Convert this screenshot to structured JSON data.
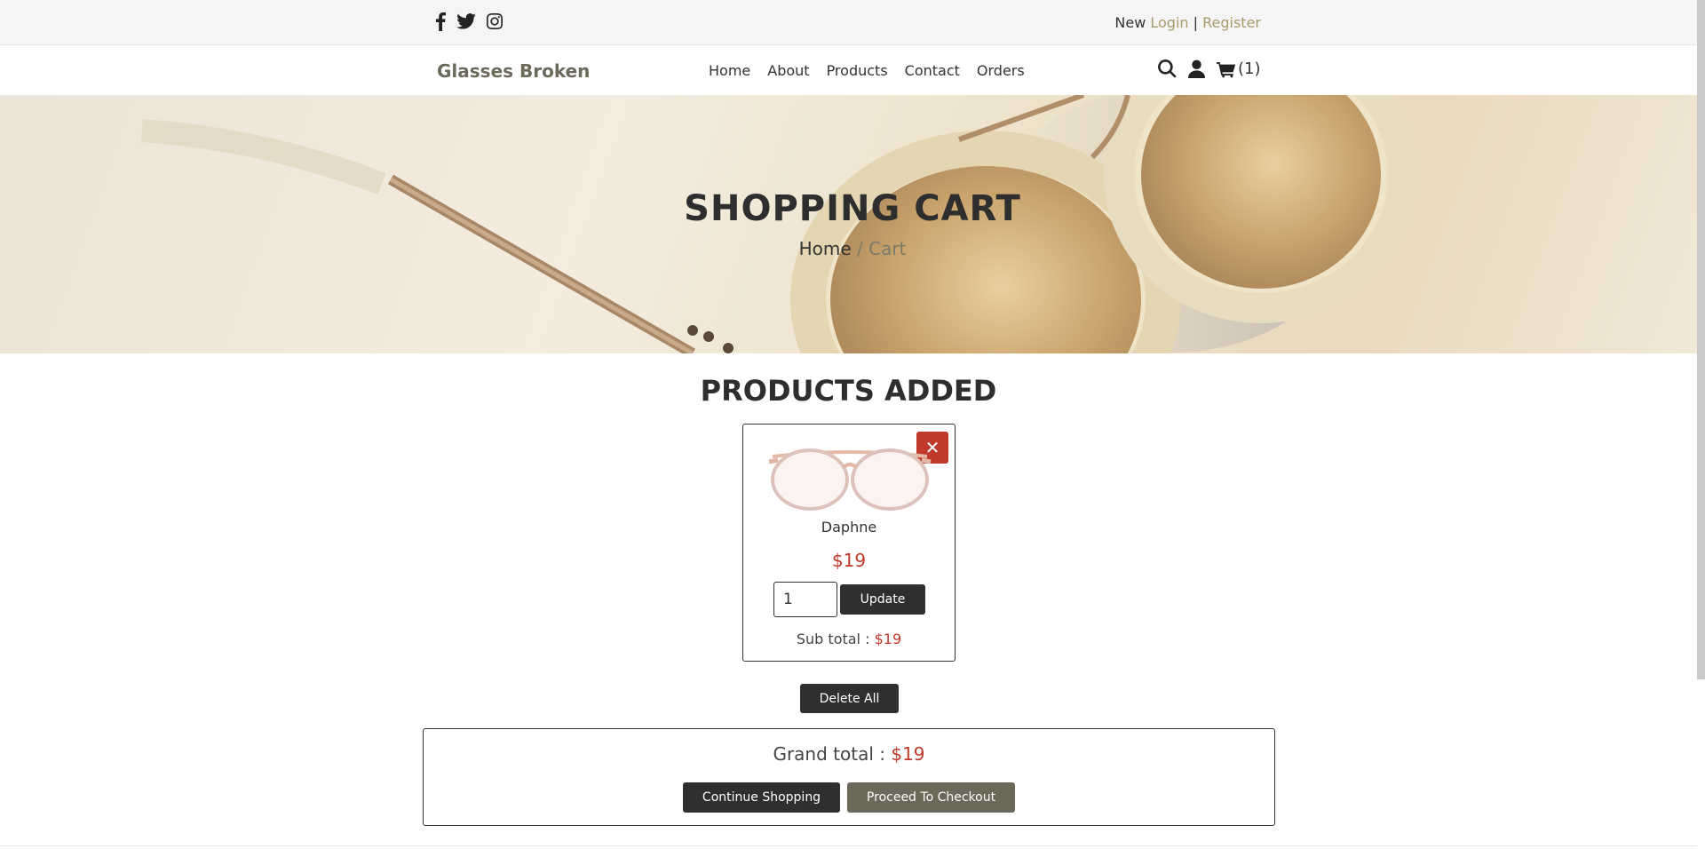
{
  "topbar": {
    "social": [
      "facebook-icon",
      "twitter-icon",
      "instagram-icon"
    ],
    "auth_prefix": "New",
    "login": "Login",
    "divider": "|",
    "register": "Register"
  },
  "navbar": {
    "brand": "Glasses Broken",
    "menu": [
      "Home",
      "About",
      "Products",
      "Contact",
      "Orders"
    ],
    "icons": [
      "search-icon",
      "user-icon",
      "cart-icon"
    ],
    "cart_count": "(1)"
  },
  "hero": {
    "title": "SHOPPING CART",
    "breadcrumb_home": "Home",
    "breadcrumb_sep": "/",
    "breadcrumb_current": "Cart"
  },
  "section_title": "PRODUCTS ADDED",
  "cart_item": {
    "remove": "✕",
    "name": "Daphne",
    "price": "$19",
    "quantity": "1",
    "update_label": "Update",
    "subtotal_label": "Sub total :",
    "subtotal_value": "$19"
  },
  "delete_all_label": "Delete All",
  "totals": {
    "grand_label": "Grand total :",
    "grand_value": "$19",
    "continue_label": "Continue Shopping",
    "checkout_label": "Proceed To Checkout"
  },
  "colors": {
    "accent": "#a89b6c",
    "price": "#c0392b",
    "dark_button": "#2f2f2f",
    "olive_button": "#6b6a5a"
  }
}
